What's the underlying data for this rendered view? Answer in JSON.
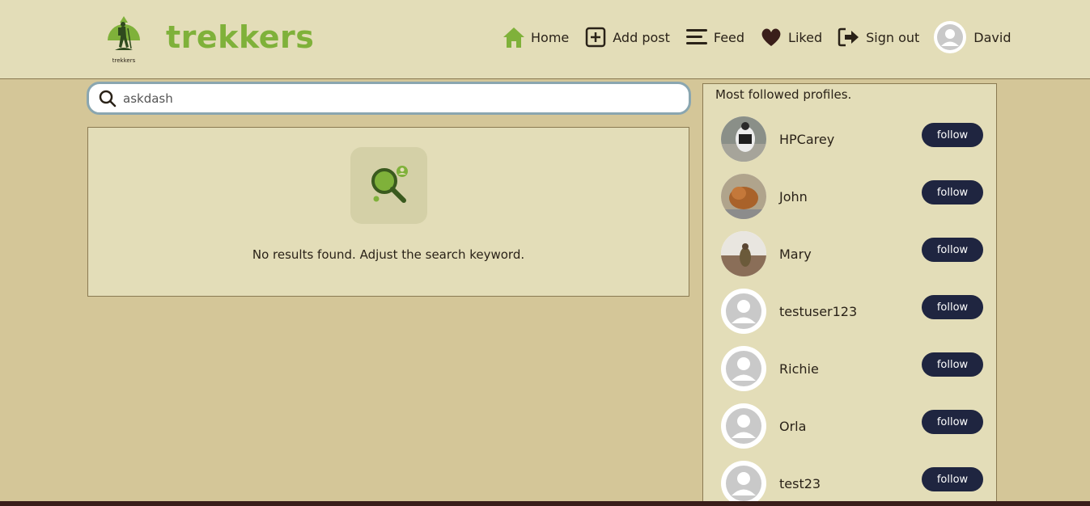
{
  "app": {
    "logo_caption": "trekkers",
    "brand": "trekkers"
  },
  "nav": {
    "items": [
      {
        "label": "Home",
        "icon": "home-icon"
      },
      {
        "label": "Add post",
        "icon": "add-post-icon"
      },
      {
        "label": "Feed",
        "icon": "feed-icon"
      },
      {
        "label": "Liked",
        "icon": "heart-icon"
      },
      {
        "label": "Sign out",
        "icon": "sign-out-icon"
      }
    ],
    "user": {
      "label": "David",
      "icon": "avatar-icon"
    }
  },
  "search": {
    "value": "askdash",
    "placeholder": ""
  },
  "results": {
    "empty_message": "No results found. Adjust the search keyword."
  },
  "sidebar": {
    "title": "Most followed profiles.",
    "profiles": [
      {
        "name": "HPCarey",
        "button": "follow",
        "avatar": "photo"
      },
      {
        "name": "John",
        "button": "follow",
        "avatar": "photo"
      },
      {
        "name": "Mary",
        "button": "follow",
        "avatar": "photo"
      },
      {
        "name": "testuser123",
        "button": "follow",
        "avatar": "default"
      },
      {
        "name": "Richie",
        "button": "follow",
        "avatar": "default"
      },
      {
        "name": "Orla",
        "button": "follow",
        "avatar": "default"
      },
      {
        "name": "test23",
        "button": "follow",
        "avatar": "default"
      }
    ]
  },
  "colors": {
    "page_bg": "#d4c698",
    "panel_bg": "#e3ddb8",
    "brand_green": "#7fb13a",
    "button_navy": "#1f2540"
  }
}
